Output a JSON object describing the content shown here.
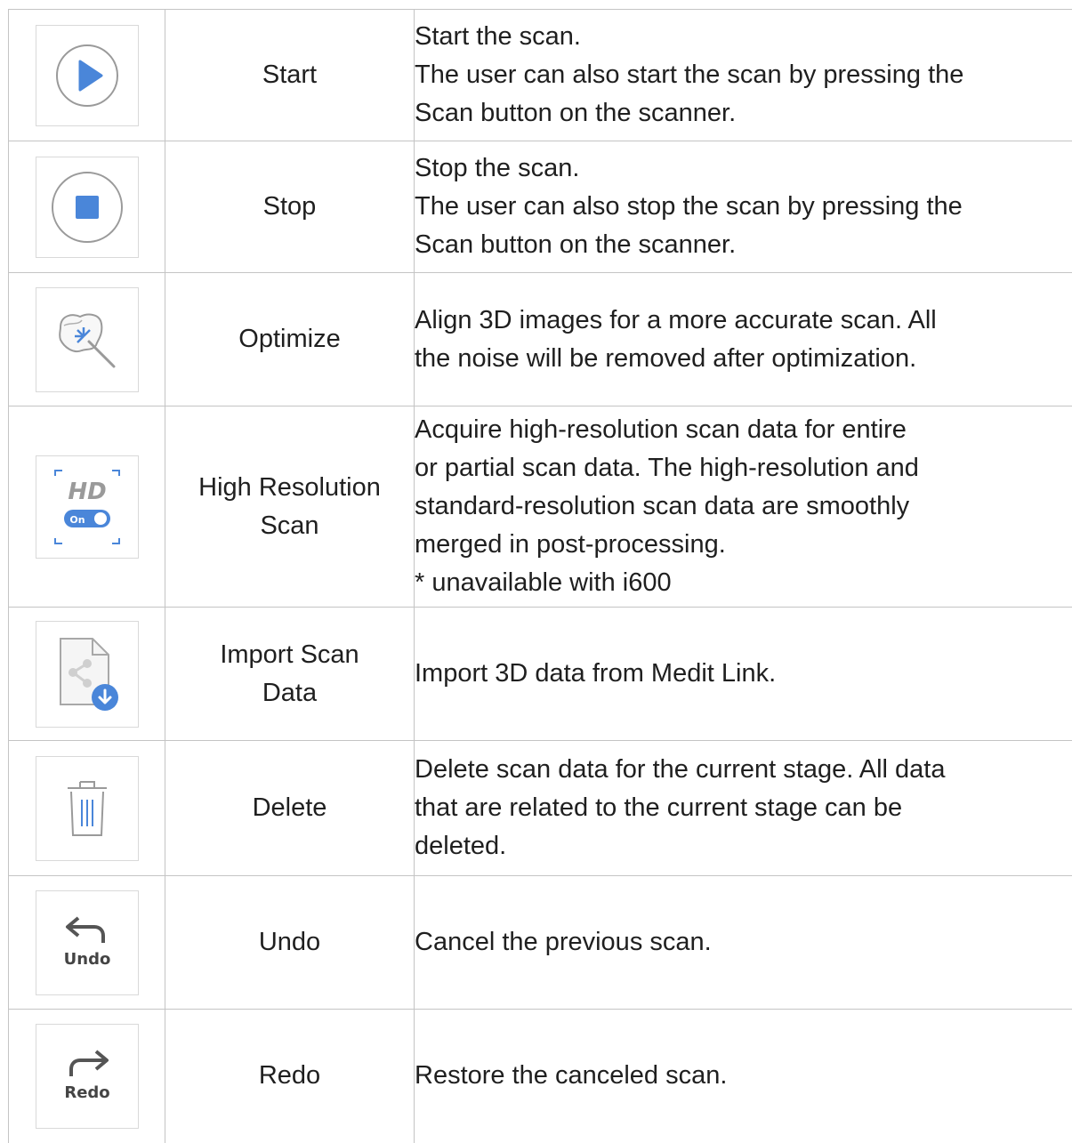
{
  "rows": [
    {
      "icon": "play-circle-icon",
      "name": [
        "Start"
      ],
      "desc": [
        "Start the scan.",
        "The user can also start the scan by pressing the",
        "Scan button on the scanner."
      ]
    },
    {
      "icon": "stop-circle-icon",
      "name": [
        "Stop"
      ],
      "desc": [
        "Stop the scan.",
        "The user can also stop the scan by pressing the",
        "Scan button on the scanner."
      ]
    },
    {
      "icon": "magic-wand-tooth-icon",
      "name": [
        "Optimize"
      ],
      "desc": [
        "Align 3D images for a more accurate scan. All",
        "the noise will be removed after optimization."
      ]
    },
    {
      "icon": "hd-toggle-icon",
      "name": [
        "High Resolution",
        "Scan"
      ],
      "icon_text": {
        "hd": "HD",
        "on": "On"
      },
      "desc": [
        "Acquire high-resolution scan data for entire",
        "or partial scan data. The high-resolution and",
        "standard-resolution scan data are smoothly",
        "merged in post-processing.",
        "* unavailable with i600"
      ]
    },
    {
      "icon": "import-file-icon",
      "name": [
        "Import Scan",
        "Data"
      ],
      "desc": [
        "Import 3D data from Medit Link."
      ]
    },
    {
      "icon": "trash-icon",
      "name": [
        "Delete"
      ],
      "desc": [
        "Delete scan data for the current stage. All data",
        "that are related to the current stage can be",
        "deleted."
      ]
    },
    {
      "icon": "undo-arrow-icon",
      "name": [
        "Undo"
      ],
      "icon_text": "Undo",
      "desc": [
        "Cancel the previous scan."
      ]
    },
    {
      "icon": "redo-arrow-icon",
      "name": [
        "Redo"
      ],
      "icon_text": "Redo",
      "desc": [
        "Restore the canceled scan."
      ]
    }
  ],
  "colors": {
    "accent": "#4a86d9",
    "border": "#c4c4c4",
    "icon_gray": "#9a9a9a"
  }
}
